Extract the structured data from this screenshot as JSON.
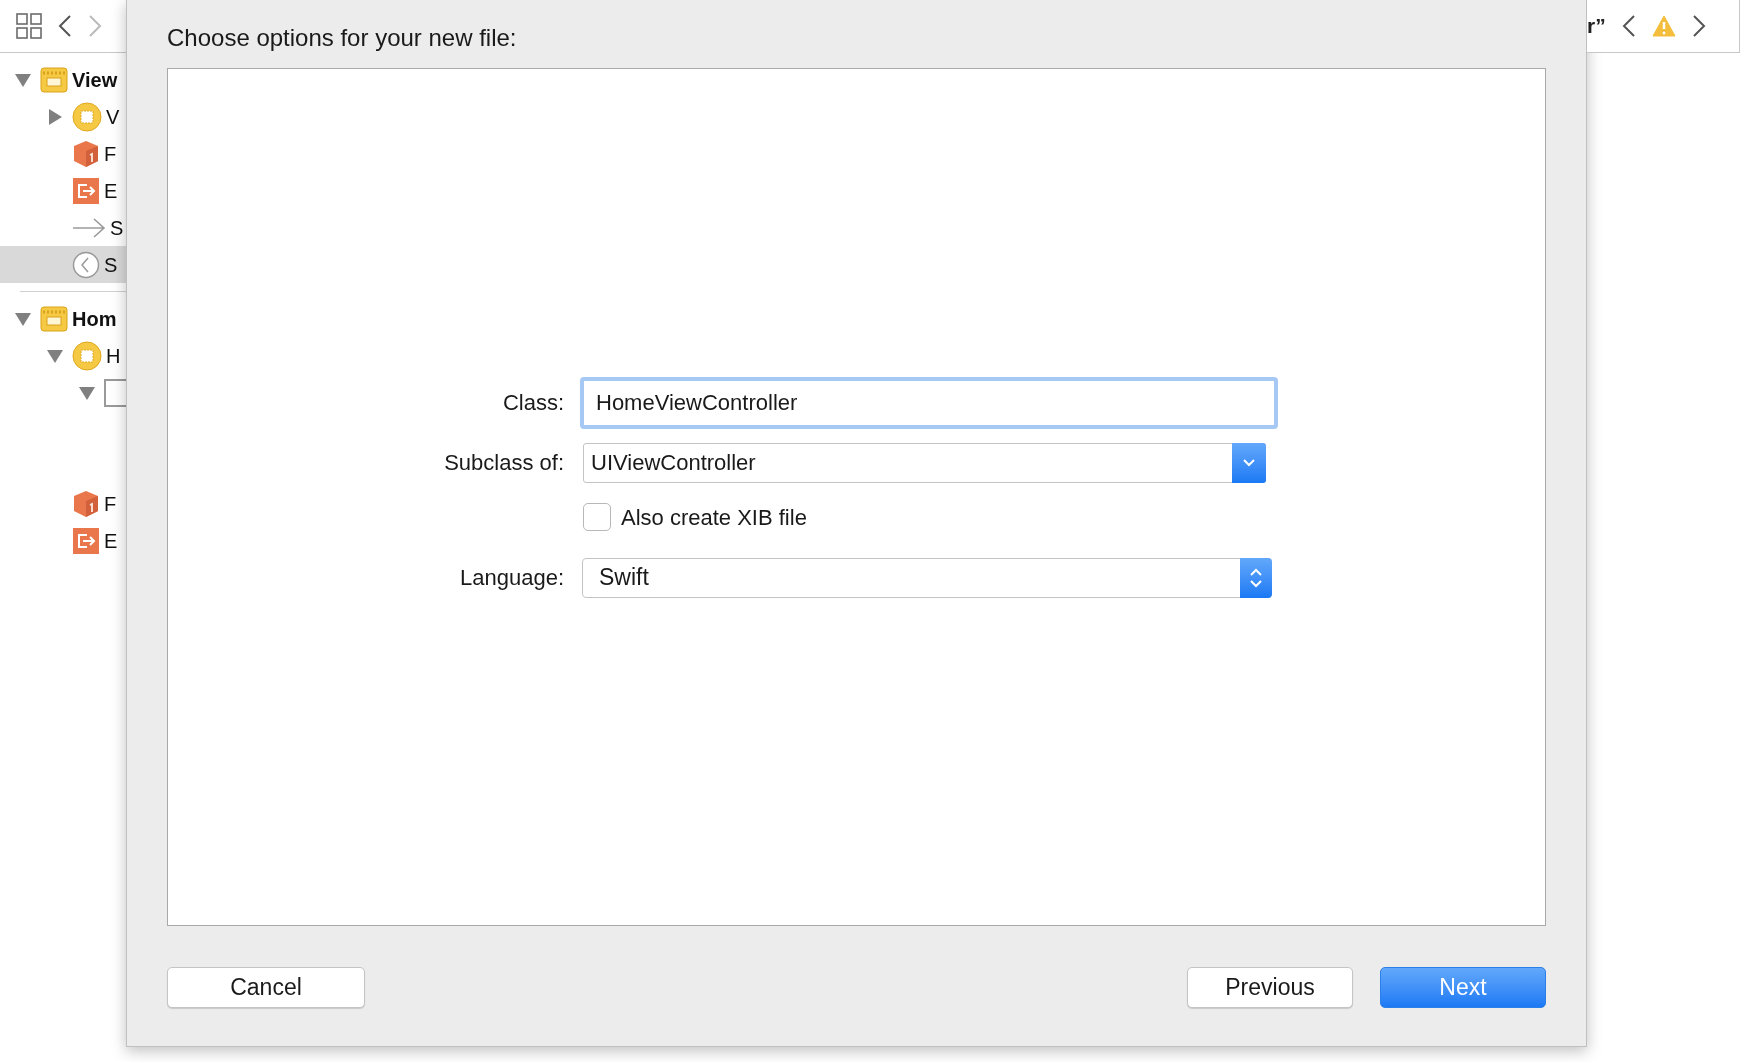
{
  "sidebar": {
    "items": [
      {
        "label": "View",
        "kind": "scene",
        "expanded": true,
        "selected": false,
        "children": [
          {
            "label": "V",
            "kind": "controller",
            "expanded": false,
            "selected": false
          },
          {
            "label": "F",
            "kind": "responder",
            "selected": false
          },
          {
            "label": "E",
            "kind": "exit",
            "selected": false
          },
          {
            "label": "S",
            "kind": "segue",
            "selected": false
          },
          {
            "label": "S",
            "kind": "back",
            "selected": true
          }
        ]
      },
      {
        "label": "Hom",
        "kind": "scene",
        "expanded": true,
        "selected": false,
        "children": [
          {
            "label": "H",
            "kind": "controller",
            "expanded": true,
            "selected": false,
            "children": [
              {
                "kind": "view",
                "expanded": true,
                "selected": false
              }
            ]
          },
          {
            "label": "F",
            "kind": "responder",
            "selected": false
          },
          {
            "label": "E",
            "kind": "exit",
            "selected": false
          }
        ]
      }
    ]
  },
  "editor": {
    "title_fragment": "r”"
  },
  "dialog": {
    "title": "Choose options for your new file:",
    "class_field": {
      "label": "Class:",
      "value": "HomeViewController",
      "focused": true
    },
    "subclass": {
      "label": "Subclass of:",
      "value": "UIViewController"
    },
    "xib_checkbox": {
      "label": "Also create XIB file",
      "checked": false
    },
    "language": {
      "label": "Language:",
      "value": "Swift"
    },
    "buttons": [
      {
        "label": "Cancel",
        "kind": "secondary"
      },
      {
        "label": "Previous",
        "kind": "secondary"
      },
      {
        "label": "Next",
        "kind": "primary"
      }
    ]
  }
}
